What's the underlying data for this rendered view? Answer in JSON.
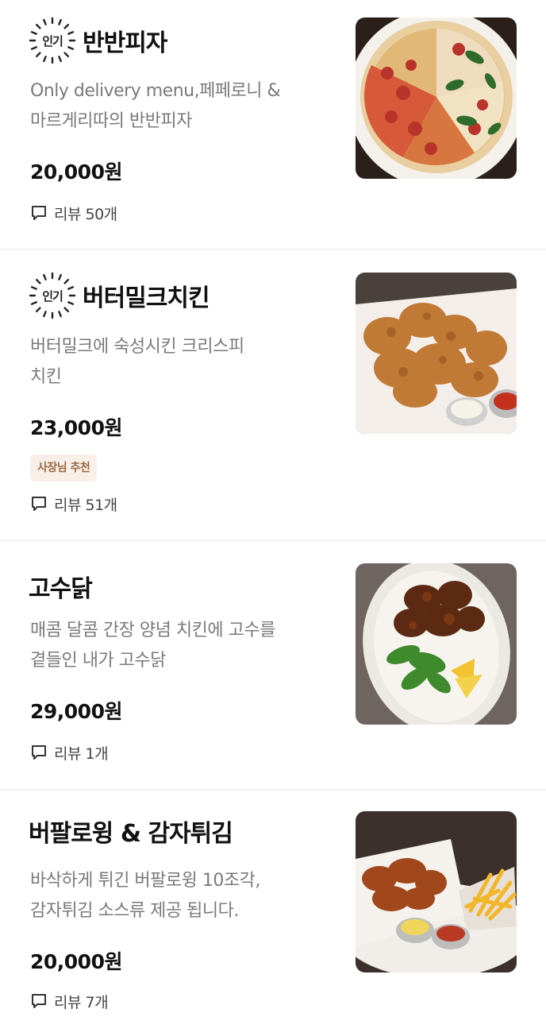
{
  "items": [
    {
      "badge": "인기",
      "title": "반반피자",
      "desc_line1": "Only delivery menu,페페로니 &",
      "desc_line2": "마르게리따의 반반피자",
      "price": "20,000원",
      "review": "리뷰 50개",
      "image": "pizza-photo"
    },
    {
      "badge": "인기",
      "title": "버터밀크치킨",
      "desc_line1": "버터밀크에 숙성시킨 크리스피",
      "desc_line2": "치킨",
      "price": "23,000원",
      "tag": "사장님 추천",
      "review": "리뷰 51개",
      "image": "fried-chicken-photo"
    },
    {
      "title": "고수닭",
      "desc_line1": "매콤 달콤 간장 양념 치킨에 고수를",
      "desc_line2": "곁들인 내가 고수닭",
      "price": "29,000원",
      "review": "리뷰 1개",
      "image": "coriander-chicken-photo"
    },
    {
      "title": "버팔로윙 & 감자튀김",
      "desc_line1": "바삭하게 튀긴 버팔로윙 10조각,",
      "desc_line2": "감자튀김  소스류 제공 됩니다.",
      "price": "20,000원",
      "review": "리뷰 7개",
      "image": "buffalo-wings-fries-photo"
    }
  ],
  "colors": {
    "tag_bg": "#f7efe8",
    "tag_text": "#9a6a44",
    "desc_text": "#7a7a7a",
    "divider": "#f2f2f2"
  }
}
